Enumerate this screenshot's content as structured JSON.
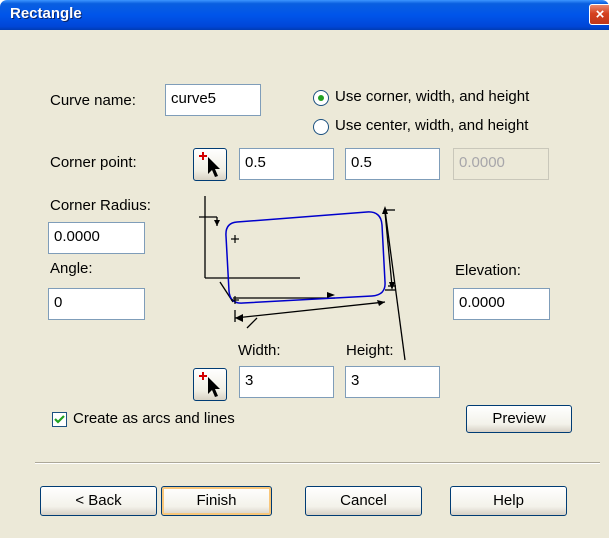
{
  "window": {
    "title": "Rectangle",
    "close_label": "×"
  },
  "form": {
    "curve_name_label": "Curve name:",
    "curve_name_value": "curve5",
    "radio_corner_label": "Use corner, width, and height",
    "radio_center_label": "Use center, width, and height",
    "radio_selected": "corner",
    "corner_point_label": "Corner point:",
    "corner_x": "0.5",
    "corner_y": "0.5",
    "corner_z": "0.0000",
    "corner_radius_label": "Corner Radius:",
    "corner_radius_value": "0.0000",
    "angle_label": "Angle:",
    "angle_value": "0",
    "elevation_label": "Elevation:",
    "elevation_value": "0.0000",
    "width_label": "Width:",
    "width_value": "3",
    "height_label": "Height:",
    "height_value": "3",
    "create_arcs_label": "Create as arcs and lines",
    "create_arcs_checked": true,
    "preview_label": "Preview"
  },
  "buttons": {
    "back": "< Back",
    "finish": "Finish",
    "cancel": "Cancel",
    "help": "Help"
  },
  "colors": {
    "title_bar": "#0055ea",
    "dialog_bg": "#ece9d8",
    "rectangle_stroke": "#0000cc",
    "radio_dot": "#21a121",
    "check_mark": "#21a121"
  },
  "icons": {
    "pick_point": "pick-point-icon",
    "close": "close-icon"
  }
}
